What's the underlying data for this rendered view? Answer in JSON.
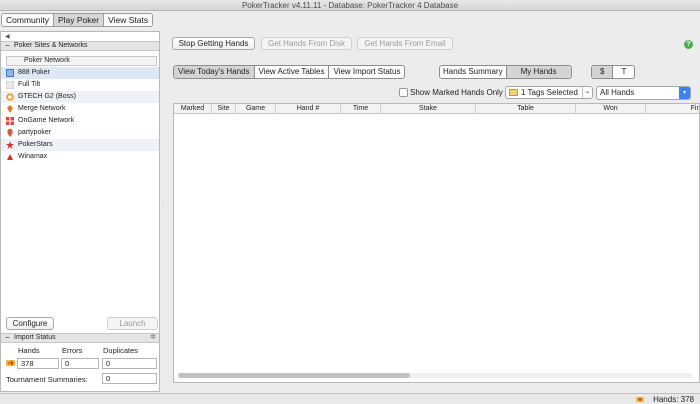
{
  "window": {
    "title": "PokerTracker v4.11.11 - Database: PokerTracker 4 Database"
  },
  "top_tabs": [
    "Community",
    "Play Poker",
    "View Stats"
  ],
  "left": {
    "sites_header": "Poker Sites & Networks",
    "column_header": "Poker Network",
    "sites": [
      {
        "label": "888 Poker",
        "icon": "888-poker-icon"
      },
      {
        "label": "Full Tilt",
        "icon": "full-tilt-icon"
      },
      {
        "label": "GTECH G2 (Boss)",
        "icon": "gtech-icon"
      },
      {
        "label": "Merge Network",
        "icon": "merge-icon"
      },
      {
        "label": "OnGame Network",
        "icon": "ongame-icon"
      },
      {
        "label": "partypoker",
        "icon": "partypoker-icon"
      },
      {
        "label": "PokerStars",
        "icon": "pokerstars-icon"
      },
      {
        "label": "Winamax",
        "icon": "winamax-icon"
      }
    ],
    "configure_label": "Configure",
    "launch_label": "Launch",
    "import_header": "Import Status",
    "hands_label": "Hands",
    "errors_label": "Errors",
    "duplicates_label": "Duplicates",
    "hands_value": "378",
    "errors_value": "0",
    "duplicates_value": "0",
    "tournament_label": "Tournament Summaries:",
    "tournament_value": "0"
  },
  "toolbar": {
    "stop_label": "Stop Getting Hands",
    "from_disk_label": "Get Hands From Disk",
    "from_email_label": "Get Hands From Email",
    "help": "?"
  },
  "view_tabs": [
    "View Today's Hands",
    "View Active Tables",
    "View Import Status"
  ],
  "summary_tabs": [
    "Hands Summary",
    "My Hands"
  ],
  "currency_tabs": [
    "$",
    "T"
  ],
  "filters": {
    "show_marked_label": "Show Marked Hands Only",
    "tags_selected": "1 Tags Selected",
    "hands_filter": "All Hands"
  },
  "grid": {
    "columns": [
      "Marked",
      "Site",
      "Game",
      "Hand #",
      "Time",
      "Stake",
      "Table",
      "Won",
      "Fin"
    ]
  },
  "status": {
    "hands_text": "Hands: 378"
  },
  "colors": {
    "accent": "#3b82f6",
    "help": "#4caf50",
    "selected_row": "#dde8f4"
  }
}
